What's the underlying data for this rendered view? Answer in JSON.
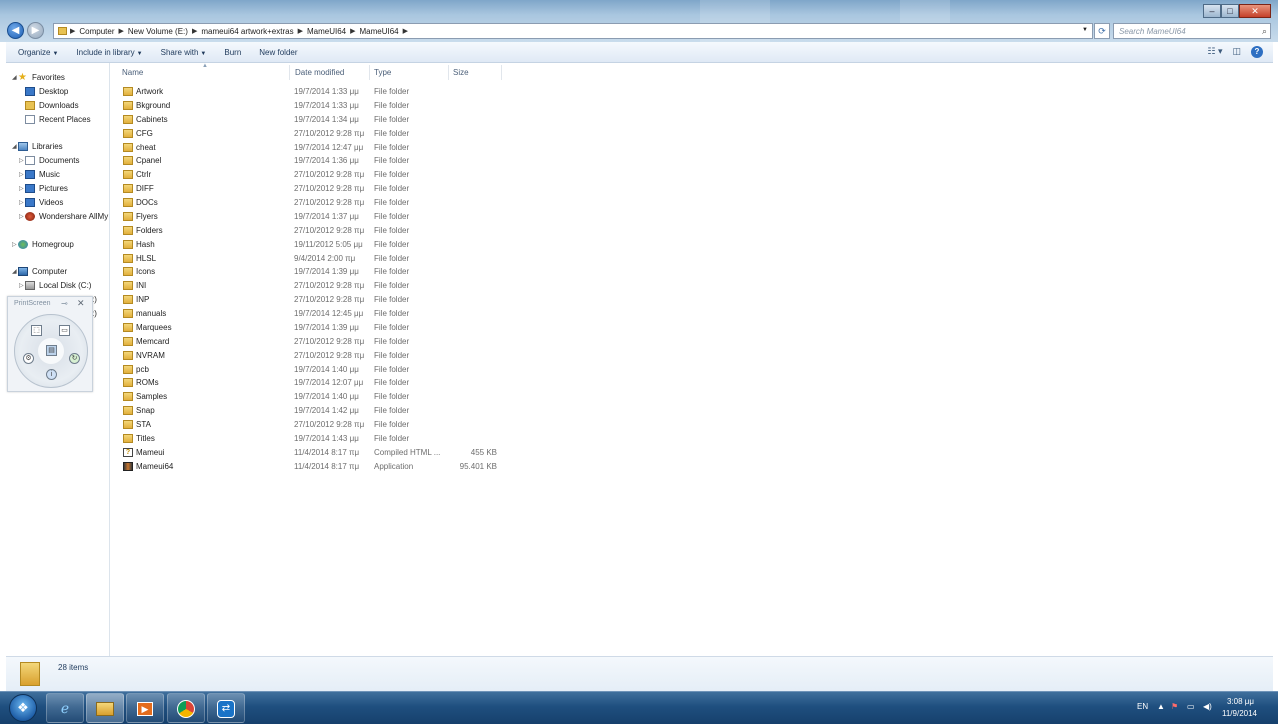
{
  "address_bar": {
    "crumbs": [
      "Computer",
      "New Volume (E:)",
      "mameui64 artwork+extras",
      "MameUI64",
      "MameUI64"
    ],
    "search_placeholder": "Search MameUI64"
  },
  "command_bar": {
    "organize": "Organize",
    "include_in_library": "Include in library",
    "share_with": "Share with",
    "burn": "Burn",
    "new_folder": "New folder"
  },
  "nav_pane": {
    "favorites": "Favorites",
    "desktop": "Desktop",
    "downloads": "Downloads",
    "recent_places": "Recent Places",
    "libraries": "Libraries",
    "documents": "Documents",
    "music": "Music",
    "pictures": "Pictures",
    "videos": "Videos",
    "wondershare": "Wondershare AllMy",
    "homegroup": "Homegroup",
    "computer": "Computer",
    "local_disk": "Local Disk (C:)",
    "drive_partial_1": ":)",
    "drive_partial_2": ":)"
  },
  "printscreen_widget": {
    "title": "PrintScreen"
  },
  "columns": {
    "name": "Name",
    "date_modified": "Date modified",
    "type": "Type",
    "size": "Size"
  },
  "files": [
    {
      "name": "Artwork",
      "date": "19/7/2014 1:33 μμ",
      "type": "File folder",
      "size": "",
      "kind": "folder"
    },
    {
      "name": "Bkground",
      "date": "19/7/2014 1:33 μμ",
      "type": "File folder",
      "size": "",
      "kind": "folder"
    },
    {
      "name": "Cabinets",
      "date": "19/7/2014 1:34 μμ",
      "type": "File folder",
      "size": "",
      "kind": "folder"
    },
    {
      "name": "CFG",
      "date": "27/10/2012 9:28 πμ",
      "type": "File folder",
      "size": "",
      "kind": "folder"
    },
    {
      "name": "cheat",
      "date": "19/7/2014 12:47 μμ",
      "type": "File folder",
      "size": "",
      "kind": "folder"
    },
    {
      "name": "Cpanel",
      "date": "19/7/2014 1:36 μμ",
      "type": "File folder",
      "size": "",
      "kind": "folder"
    },
    {
      "name": "Ctrlr",
      "date": "27/10/2012 9:28 πμ",
      "type": "File folder",
      "size": "",
      "kind": "folder"
    },
    {
      "name": "DIFF",
      "date": "27/10/2012 9:28 πμ",
      "type": "File folder",
      "size": "",
      "kind": "folder"
    },
    {
      "name": "DOCs",
      "date": "27/10/2012 9:28 πμ",
      "type": "File folder",
      "size": "",
      "kind": "folder"
    },
    {
      "name": "Flyers",
      "date": "19/7/2014 1:37 μμ",
      "type": "File folder",
      "size": "",
      "kind": "folder"
    },
    {
      "name": "Folders",
      "date": "27/10/2012 9:28 πμ",
      "type": "File folder",
      "size": "",
      "kind": "folder"
    },
    {
      "name": "Hash",
      "date": "19/11/2012 5:05 μμ",
      "type": "File folder",
      "size": "",
      "kind": "folder"
    },
    {
      "name": "HLSL",
      "date": "9/4/2014 2:00 πμ",
      "type": "File folder",
      "size": "",
      "kind": "folder"
    },
    {
      "name": "Icons",
      "date": "19/7/2014 1:39 μμ",
      "type": "File folder",
      "size": "",
      "kind": "folder"
    },
    {
      "name": "INI",
      "date": "27/10/2012 9:28 πμ",
      "type": "File folder",
      "size": "",
      "kind": "folder"
    },
    {
      "name": "INP",
      "date": "27/10/2012 9:28 πμ",
      "type": "File folder",
      "size": "",
      "kind": "folder"
    },
    {
      "name": "manuals",
      "date": "19/7/2014 12:45 μμ",
      "type": "File folder",
      "size": "",
      "kind": "folder"
    },
    {
      "name": "Marquees",
      "date": "19/7/2014 1:39 μμ",
      "type": "File folder",
      "size": "",
      "kind": "folder"
    },
    {
      "name": "Memcard",
      "date": "27/10/2012 9:28 πμ",
      "type": "File folder",
      "size": "",
      "kind": "folder"
    },
    {
      "name": "NVRAM",
      "date": "27/10/2012 9:28 πμ",
      "type": "File folder",
      "size": "",
      "kind": "folder"
    },
    {
      "name": "pcb",
      "date": "19/7/2014 1:40 μμ",
      "type": "File folder",
      "size": "",
      "kind": "folder"
    },
    {
      "name": "ROMs",
      "date": "19/7/2014 12:07 μμ",
      "type": "File folder",
      "size": "",
      "kind": "folder"
    },
    {
      "name": "Samples",
      "date": "19/7/2014 1:40 μμ",
      "type": "File folder",
      "size": "",
      "kind": "folder"
    },
    {
      "name": "Snap",
      "date": "19/7/2014 1:42 μμ",
      "type": "File folder",
      "size": "",
      "kind": "folder"
    },
    {
      "name": "STA",
      "date": "27/10/2012 9:28 πμ",
      "type": "File folder",
      "size": "",
      "kind": "folder"
    },
    {
      "name": "Titles",
      "date": "19/7/2014 1:43 μμ",
      "type": "File folder",
      "size": "",
      "kind": "folder"
    },
    {
      "name": "Mameui",
      "date": "11/4/2014 8:17 πμ",
      "type": "Compiled HTML ...",
      "size": "455 KB",
      "kind": "chm"
    },
    {
      "name": "Mameui64",
      "date": "11/4/2014 8:17 πμ",
      "type": "Application",
      "size": "95.401 KB",
      "kind": "app"
    }
  ],
  "details_pane": {
    "items_count": "28 items"
  },
  "taskbar": {
    "language": "EN",
    "time": "3:08 μμ",
    "date": "11/9/2014"
  }
}
